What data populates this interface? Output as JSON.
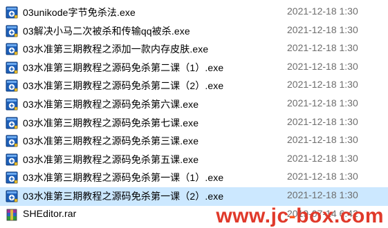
{
  "files": [
    {
      "name": "03unikode字节免杀法.exe",
      "date": "2021-12-18 1:30",
      "icon": "exe-icon"
    },
    {
      "name": "03解决小马二次被杀和传输qq被杀.exe",
      "date": "2021-12-18 1:30",
      "icon": "exe-icon"
    },
    {
      "name": "03水准第三期教程之添加一款内存皮肤.exe",
      "date": "2021-12-18 1:30",
      "icon": "exe-icon"
    },
    {
      "name": "03水准第三期教程之源码免杀第二课（1）.exe",
      "date": "2021-12-18 1:30",
      "icon": "exe-icon"
    },
    {
      "name": "03水准第三期教程之源码免杀第二课（2）.exe",
      "date": "2021-12-18 1:30",
      "icon": "exe-icon"
    },
    {
      "name": "03水准第三期教程之源码免杀第六课.exe",
      "date": "2021-12-18 1:30",
      "icon": "exe-icon"
    },
    {
      "name": "03水准第三期教程之源码免杀第七课.exe",
      "date": "2021-12-18 1:30",
      "icon": "exe-icon"
    },
    {
      "name": "03水准第三期教程之源码免杀第三课.exe",
      "date": "2021-12-18 1:30",
      "icon": "exe-icon"
    },
    {
      "name": "03水准第三期教程之源码免杀第五课.exe",
      "date": "2021-12-18 1:30",
      "icon": "exe-icon"
    },
    {
      "name": "03水准第三期教程之源码免杀第一课（1）.exe",
      "date": "2021-12-18 1:30",
      "icon": "exe-icon"
    },
    {
      "name": "03水准第三期教程之源码免杀第一课（2）.exe",
      "date": "2021-12-18 1:30",
      "icon": "exe-icon"
    },
    {
      "name": "SHEditor.rar",
      "date": "2019-07-14 6:42",
      "icon": "rar-archive-icon"
    }
  ],
  "selected_index": 10,
  "colors": {
    "selection": "#cce8ff",
    "date_text": "#6d6d6d",
    "watermark": "#e0392a"
  },
  "watermark": {
    "text_pre": "www.jc",
    "text_accent": "-",
    "text_post": "box.com"
  }
}
